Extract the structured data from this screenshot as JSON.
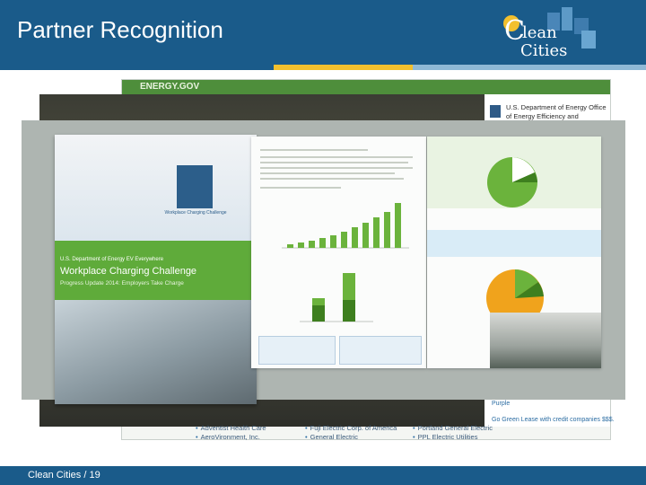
{
  "slide": {
    "title": "Partner Recognition",
    "footer": "Clean Cities  /  19"
  },
  "logo": {
    "line1": "lean",
    "line2": "Cities",
    "initial": "C"
  },
  "website": {
    "brand": "ENERGY.GOV",
    "sidebar_text": "U.S. Department of Energy Office of Energy Efficiency and Renewable Energy",
    "side_snippets": [
      "Purple",
      "Go Green Lease with credit companies $$$."
    ],
    "partners_col1": [
      "Adventist Health Care",
      "AeroVironment, Inc."
    ],
    "partners_col2": [
      "Fuji Electric Corp. of America",
      "General Electric"
    ],
    "partners_col3": [
      "Portland General Electric",
      "PPL Electric Utilities"
    ]
  },
  "brochure": {
    "cover_line1": "U.S. Department of Energy EV Everywhere",
    "cover_title": "Workplace Charging Challenge",
    "cover_subtitle": "Progress Update 2014: Employers Take Charge",
    "cover_logo_text": "Workplace Charging Challenge"
  },
  "colors": {
    "header_blue": "#1a5b8a",
    "accent_yellow": "#f2c02e",
    "brochure_green": "#6bb33c",
    "pie_orange": "#f0a31c"
  }
}
